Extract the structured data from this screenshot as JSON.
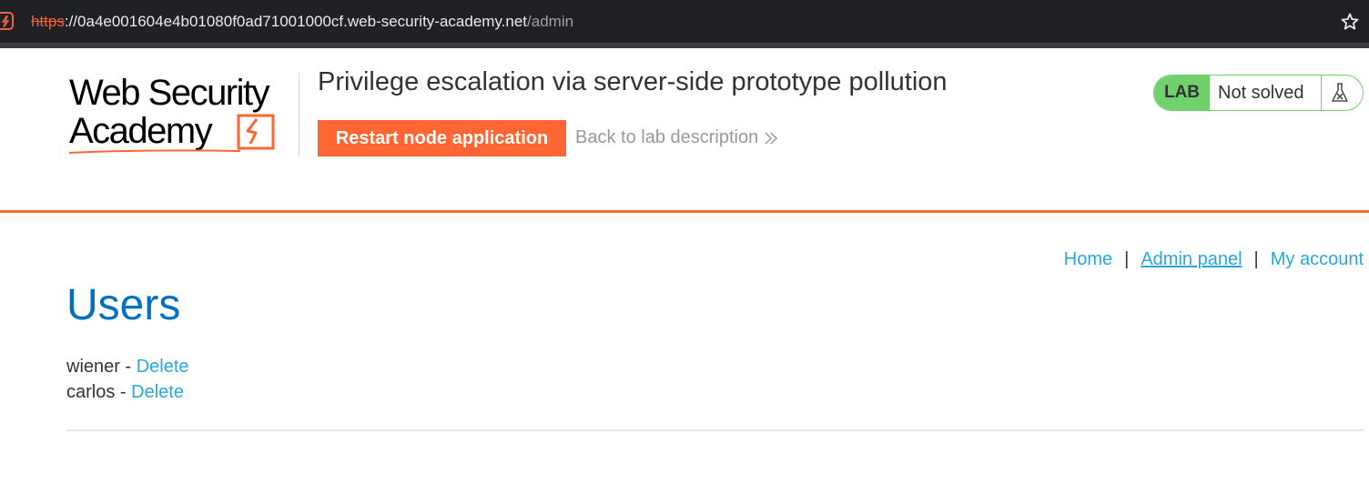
{
  "browser": {
    "url_scheme": "https",
    "url_host": "://0a4e001604e4b01080f0ad71001000cf.web-security-academy.net",
    "url_path": "/admin",
    "site_icon": "lightning-bolt-icon",
    "bookmark_icon": "star-icon"
  },
  "header": {
    "logo_line1": "Web Security",
    "logo_line2": "Academy",
    "lab_title": "Privilege escalation via server-side prototype pollution",
    "restart_label": "Restart node application",
    "back_label": "Back to lab description",
    "back_icon": "double-chevron-right-icon",
    "lab_tag": "LAB",
    "lab_status": "Not solved",
    "lab_status_icon": "flask-icon"
  },
  "nav": {
    "home": "Home",
    "admin_panel": "Admin panel",
    "my_account": "My account",
    "separator": "|"
  },
  "main": {
    "heading": "Users",
    "users": [
      {
        "name": "wiener",
        "sep": " - ",
        "action": "Delete"
      },
      {
        "name": "carlos",
        "sep": " - ",
        "action": "Delete"
      }
    ]
  },
  "colors": {
    "accent": "#ff6633",
    "link": "#29a7e1",
    "heading": "#0071bc",
    "lab_green": "#70d16d"
  }
}
